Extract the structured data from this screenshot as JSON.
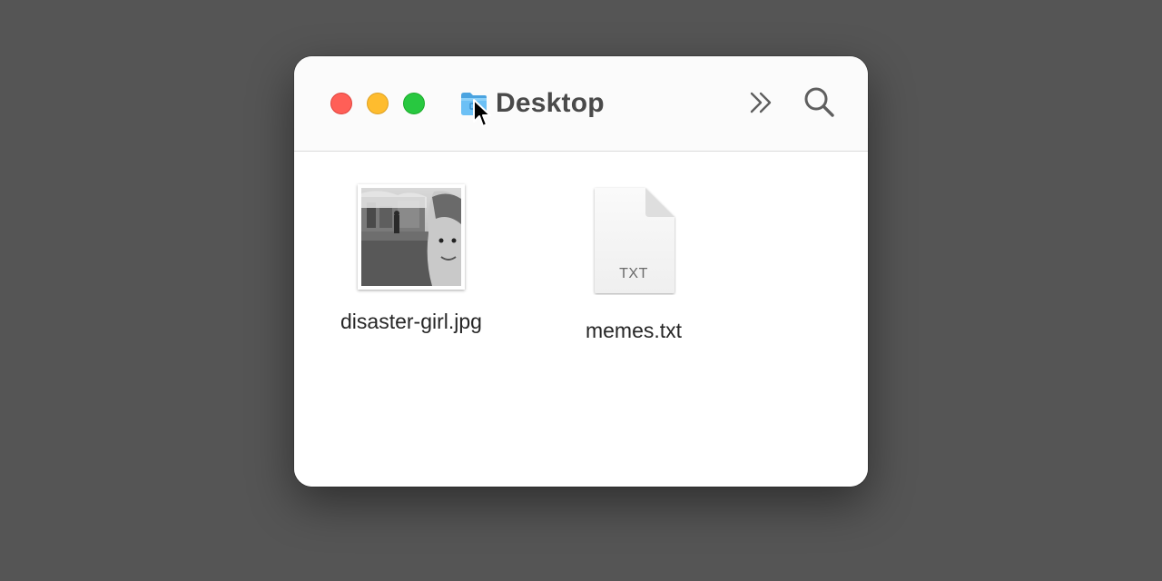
{
  "window": {
    "title": "Desktop",
    "folder_icon": "folder-icon",
    "toolbar": {
      "traffic_lights": {
        "close_color": "#ff5f57",
        "minimize_color": "#febc2e",
        "zoom_color": "#28c840"
      },
      "overflow_icon": "chevron-double-right-icon",
      "search_icon": "search-icon"
    }
  },
  "files": [
    {
      "name": "disaster-girl.jpg",
      "kind": "image-thumbnail"
    },
    {
      "name": "memes.txt",
      "kind": "text-document",
      "badge": "TXT"
    }
  ],
  "colors": {
    "desktop_background": "#555555",
    "window_background": "#ffffff",
    "folder_blue": "#5ab3f0"
  }
}
